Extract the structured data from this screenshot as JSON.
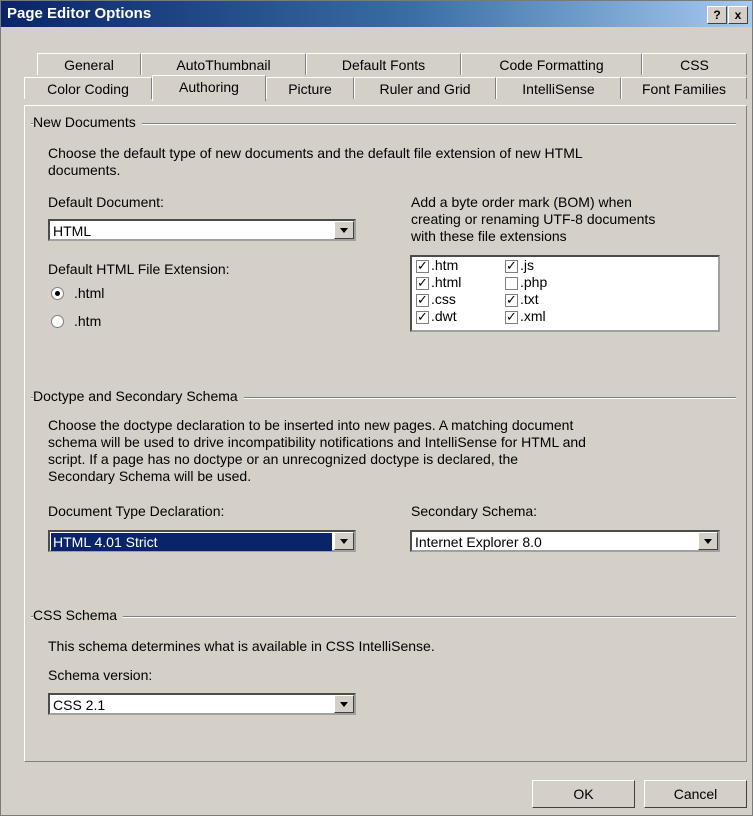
{
  "window": {
    "title": "Page Editor Options",
    "help_label": "?",
    "close_label": "x"
  },
  "tabs_row1": [
    "General",
    "AutoThumbnail",
    "Default Fonts",
    "Code Formatting",
    "CSS"
  ],
  "tabs_row2": [
    "Color Coding",
    "Authoring",
    "Picture",
    "Ruler and Grid",
    "IntelliSense",
    "Font Families"
  ],
  "active_tab": "Authoring",
  "new_documents": {
    "heading": "New Documents",
    "description_line1": "Choose the default type of new documents and the default file extension of new HTML",
    "description_line2": "documents.",
    "default_document_label": "Default Document:",
    "default_document_value": "HTML",
    "default_extension_label": "Default HTML File Extension:",
    "ext_options": [
      ".html",
      ".htm"
    ],
    "ext_selected": ".html",
    "bom_line1": "Add a byte order mark (BOM) when",
    "bom_line2": "creating or renaming UTF-8 documents",
    "bom_line3": "with these file extensions",
    "bom_extensions": [
      {
        "label": ".htm",
        "checked": true
      },
      {
        "label": ".js",
        "checked": true
      },
      {
        "label": ".html",
        "checked": true
      },
      {
        "label": ".php",
        "checked": false
      },
      {
        "label": ".css",
        "checked": true
      },
      {
        "label": ".txt",
        "checked": true
      },
      {
        "label": ".dwt",
        "checked": true
      },
      {
        "label": ".xml",
        "checked": true
      }
    ]
  },
  "doctype": {
    "heading": "Doctype and Secondary Schema",
    "line1": "Choose the doctype declaration to be inserted into new pages. A matching document",
    "line2": "schema will be used to drive incompatibility notifications and IntelliSense for HTML and",
    "line3": "script. If a page has no doctype or an unrecognized doctype is declared, the",
    "line4": "Secondary Schema will be used.",
    "doctype_label": "Document Type Declaration:",
    "doctype_value": "HTML 4.01 Strict",
    "secondary_label": "Secondary Schema:",
    "secondary_value": "Internet Explorer 8.0"
  },
  "css_schema": {
    "heading": "CSS Schema",
    "description": "This schema determines what is available in CSS IntelliSense.",
    "version_label": "Schema version:",
    "version_value": "CSS 2.1"
  },
  "buttons": {
    "ok": "OK",
    "cancel": "Cancel"
  }
}
